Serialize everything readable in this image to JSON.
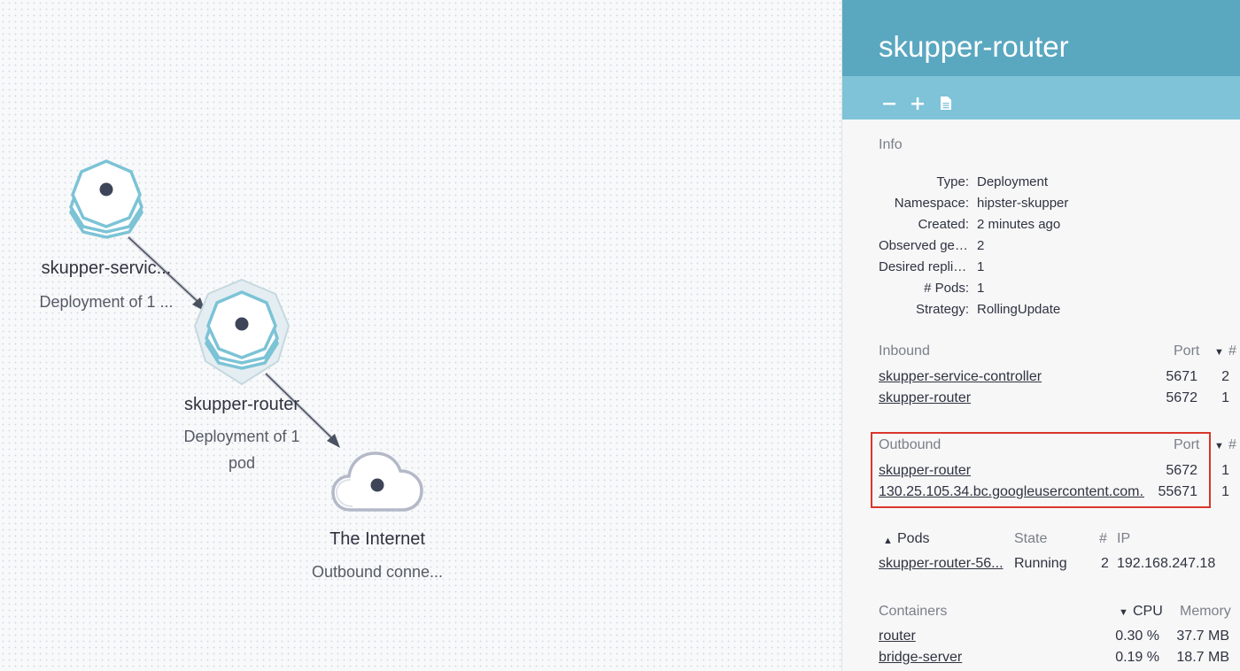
{
  "graph": {
    "nodes": [
      {
        "id": "svc",
        "label": "skupper-servic...",
        "sub": "Deployment of 1 ...",
        "type": "deployment",
        "icon": "hexagon-stack-icon"
      },
      {
        "id": "router",
        "label": "skupper-router",
        "sub": "Deployment of 1\npod",
        "type": "deployment",
        "icon": "hexagon-stack-icon",
        "selected": true
      },
      {
        "id": "internet",
        "label": "The Internet",
        "sub": "Outbound conne...",
        "type": "external",
        "icon": "cloud-icon"
      }
    ],
    "colors": {
      "node_stroke": "#7cc3d6",
      "node_dot": "#3e4558",
      "cloud_stroke": "#b4b9c8",
      "edge": "#c9cdd3",
      "arrow": "#4a5160"
    }
  },
  "panel": {
    "title": "skupper-router",
    "toolbar": {
      "zoom_out": "−",
      "zoom_in": "+",
      "details": "document-icon"
    },
    "info": {
      "title": "Info",
      "rows": [
        {
          "key": "Type:",
          "value": "Deployment"
        },
        {
          "key": "Namespace:",
          "value": "hipster-skupper"
        },
        {
          "key": "Created:",
          "value": "2 minutes ago"
        },
        {
          "key": "Observed gen.:",
          "value": "2"
        },
        {
          "key": "Desired replic...",
          "value": "1"
        },
        {
          "key": "# Pods:",
          "value": "1"
        },
        {
          "key": "Strategy:",
          "value": "RollingUpdate"
        }
      ]
    },
    "inbound": {
      "title": "Inbound",
      "col_port": "Port",
      "col_count": "#",
      "rows": [
        {
          "name": "skupper-service-controller",
          "port": "5671",
          "count": "2"
        },
        {
          "name": "skupper-router",
          "port": "5672",
          "count": "1"
        }
      ]
    },
    "outbound": {
      "title": "Outbound",
      "col_port": "Port",
      "col_count": "#",
      "rows": [
        {
          "name": "skupper-router",
          "port": "5672",
          "count": "1"
        },
        {
          "name": "130.25.105.34.bc.googleusercontent.com...",
          "port": "55671",
          "count": "1"
        }
      ]
    },
    "pods": {
      "title": "Pods",
      "col_state": "State",
      "col_count": "#",
      "col_ip": "IP",
      "rows": [
        {
          "name": "skupper-router-56...",
          "state": "Running",
          "count": "2",
          "ip": "192.168.247.18"
        }
      ]
    },
    "containers": {
      "title": "Containers",
      "col_cpu": "CPU",
      "col_memory": "Memory",
      "rows": [
        {
          "name": "router",
          "cpu": "0.30 %",
          "memory": "37.7 MB"
        },
        {
          "name": "bridge-server",
          "cpu": "0.19 %",
          "memory": "18.7 MB"
        }
      ]
    }
  }
}
